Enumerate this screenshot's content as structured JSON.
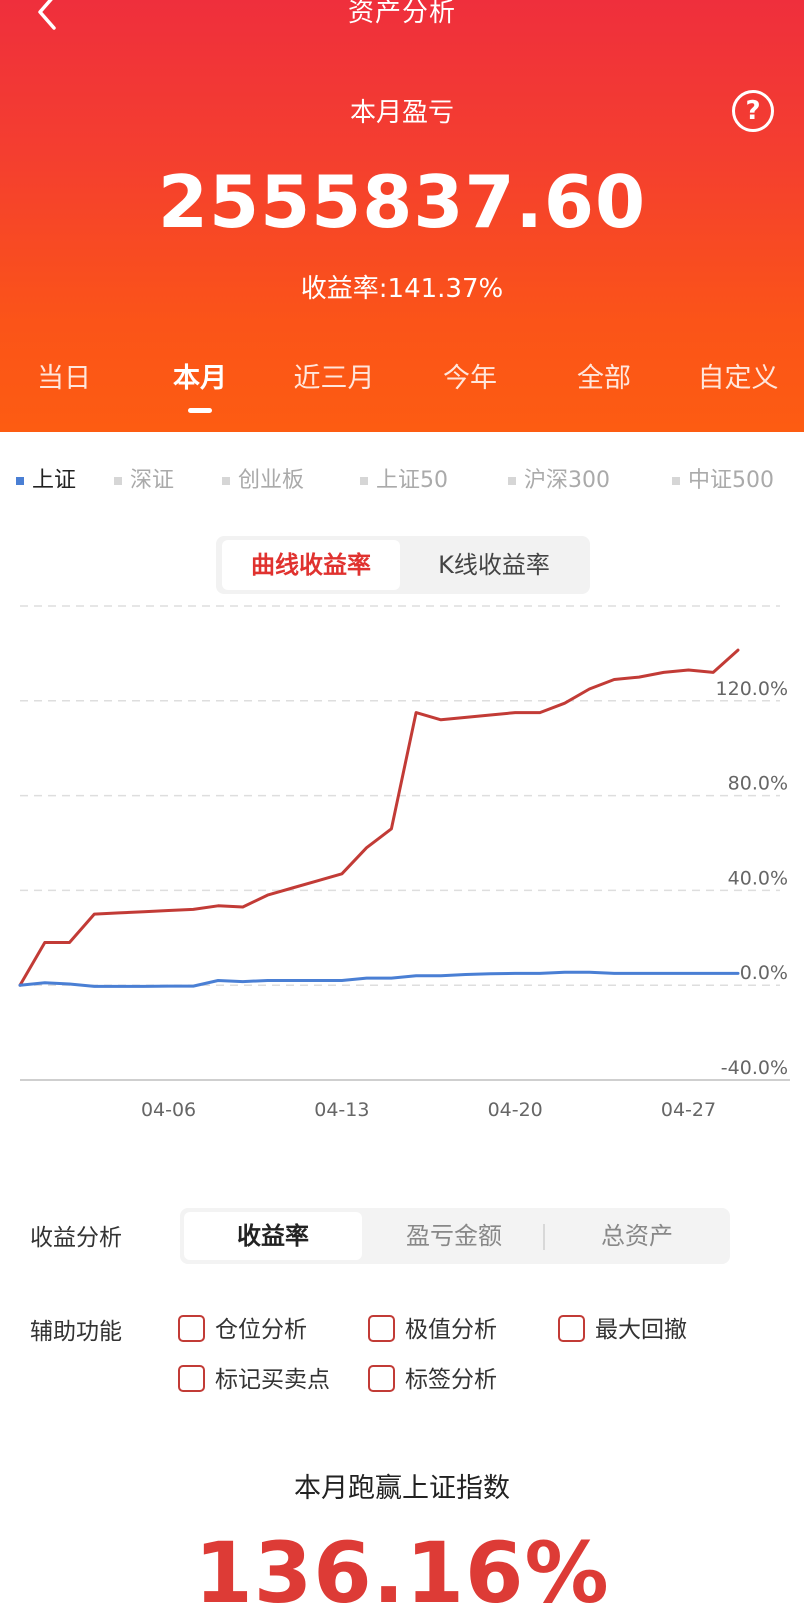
{
  "header": {
    "title": "资产分析",
    "profit_label": "本月盈亏",
    "help_glyph": "?",
    "profit_amount": "2555837.60",
    "return_rate": "收益率:141.37%",
    "colors": {
      "gradient_top": "#ef2f3c",
      "gradient_bottom": "#fd5c12"
    }
  },
  "period_tabs": [
    {
      "label": "当日",
      "active": false
    },
    {
      "label": "本月",
      "active": true
    },
    {
      "label": "近三月",
      "active": false
    },
    {
      "label": "今年",
      "active": false
    },
    {
      "label": "全部",
      "active": false
    },
    {
      "label": "自定义",
      "active": false
    }
  ],
  "index_tabs": [
    {
      "label": "上证",
      "active": true
    },
    {
      "label": "深证",
      "active": false
    },
    {
      "label": "创业板",
      "active": false
    },
    {
      "label": "上证50",
      "active": false
    },
    {
      "label": "沪深300",
      "active": false
    },
    {
      "label": "中证500",
      "active": false
    }
  ],
  "chart_mode": {
    "curve": "曲线收益率",
    "kline": "K线收益率",
    "active": "curve"
  },
  "chart_data": {
    "type": "line",
    "xlabel": "",
    "ylabel": "",
    "ylim": [
      -40,
      160
    ],
    "y_ticks": [
      -40,
      0,
      40,
      80,
      120
    ],
    "y_tick_labels": [
      "-40.0%",
      "0.0%",
      "40.0%",
      "80.0%",
      "120.0%"
    ],
    "x_ticks": [
      "04-06",
      "04-13",
      "04-20",
      "04-27"
    ],
    "grid": true,
    "series": [
      {
        "color": "#c23b36",
        "points": [
          [
            0,
            0
          ],
          [
            1,
            18
          ],
          [
            2,
            18
          ],
          [
            3,
            30
          ],
          [
            4,
            30.5
          ],
          [
            5,
            31
          ],
          [
            6,
            31.5
          ],
          [
            7,
            32
          ],
          [
            8,
            33.5
          ],
          [
            9,
            33
          ],
          [
            10,
            38
          ],
          [
            11,
            41
          ],
          [
            12,
            44
          ],
          [
            13,
            47
          ],
          [
            14,
            58
          ],
          [
            15,
            66
          ],
          [
            16,
            115
          ],
          [
            17,
            112
          ],
          [
            18,
            113
          ],
          [
            19,
            114
          ],
          [
            20,
            115
          ],
          [
            21,
            115
          ],
          [
            22,
            119
          ],
          [
            23,
            125
          ],
          [
            24,
            129
          ],
          [
            25,
            130
          ],
          [
            26,
            132
          ],
          [
            27,
            133
          ],
          [
            28,
            132
          ],
          [
            29,
            141.4
          ]
        ]
      },
      {
        "color": "#4a7fd4",
        "points": [
          [
            0,
            0
          ],
          [
            1,
            1
          ],
          [
            2,
            0.5
          ],
          [
            3,
            -0.5
          ],
          [
            4,
            -0.5
          ],
          [
            5,
            -0.5
          ],
          [
            6,
            -0.4
          ],
          [
            7,
            -0.4
          ],
          [
            8,
            2
          ],
          [
            9,
            1.5
          ],
          [
            10,
            2
          ],
          [
            11,
            2
          ],
          [
            12,
            2
          ],
          [
            13,
            2
          ],
          [
            14,
            3
          ],
          [
            15,
            3
          ],
          [
            16,
            4
          ],
          [
            17,
            4
          ],
          [
            18,
            4.5
          ],
          [
            19,
            4.8
          ],
          [
            20,
            5
          ],
          [
            21,
            5
          ],
          [
            22,
            5.5
          ],
          [
            23,
            5.5
          ],
          [
            24,
            5
          ],
          [
            25,
            5
          ],
          [
            26,
            5
          ],
          [
            27,
            5
          ],
          [
            28,
            5
          ],
          [
            29,
            5
          ]
        ]
      }
    ],
    "x_tick_positions": [
      6,
      13,
      20,
      27
    ],
    "x_range": [
      0,
      29
    ]
  },
  "analysis": {
    "label": "收益分析",
    "options": [
      {
        "label": "收益率",
        "active": true
      },
      {
        "label": "盈亏金额",
        "active": false
      },
      {
        "label": "总资产",
        "active": false
      }
    ]
  },
  "aux": {
    "label": "辅助功能",
    "options": [
      "仓位分析",
      "极值分析",
      "最大回撤",
      "标记买卖点",
      "标签分析"
    ]
  },
  "summary": {
    "beat_label": "本月跑赢上证指数",
    "beat_value": "136.16%",
    "color": "#dd3b36"
  }
}
